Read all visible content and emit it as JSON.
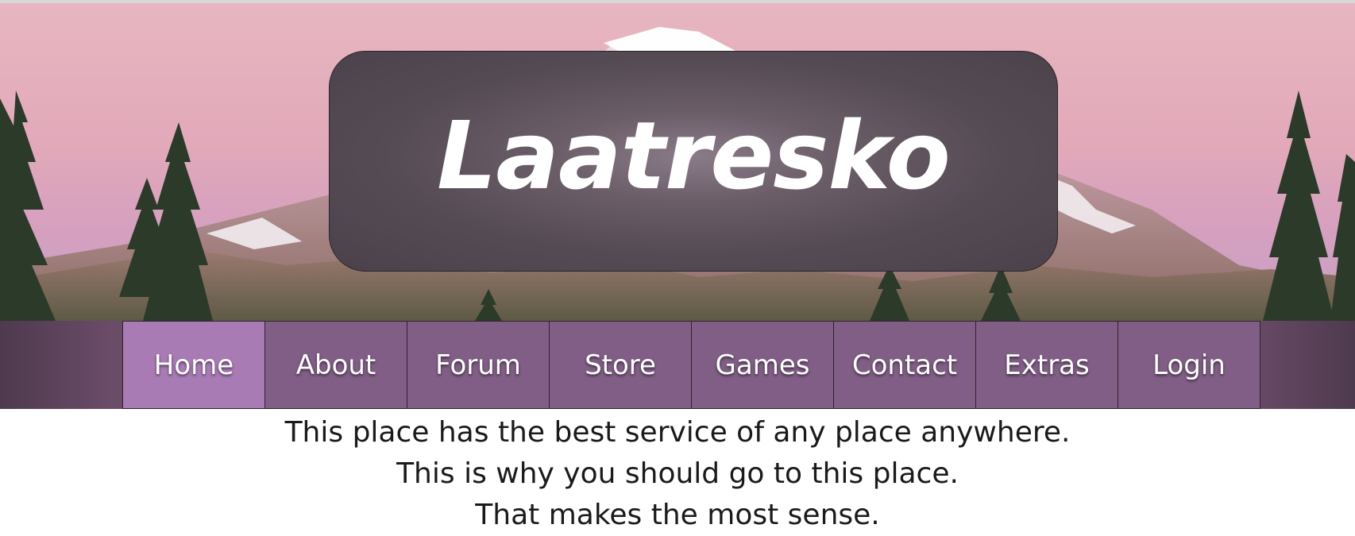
{
  "site": {
    "title": "Laatresko"
  },
  "nav": {
    "items": [
      {
        "label": "Home",
        "active": true
      },
      {
        "label": "About",
        "active": false
      },
      {
        "label": "Forum",
        "active": false
      },
      {
        "label": "Store",
        "active": false
      },
      {
        "label": "Games",
        "active": false
      },
      {
        "label": "Contact",
        "active": false
      },
      {
        "label": "Extras",
        "active": false
      },
      {
        "label": "Login",
        "active": false
      }
    ]
  },
  "content": {
    "lines": [
      "This place has the best service of any place anywhere.",
      "This is why you should go to this place.",
      "That makes the most sense."
    ]
  },
  "colors": {
    "nav_bar": "#6a4b68",
    "nav_item": "#815e86",
    "nav_item_active": "#a87bb4",
    "title_box": "#554b55",
    "sky": "#e2a9b9"
  }
}
